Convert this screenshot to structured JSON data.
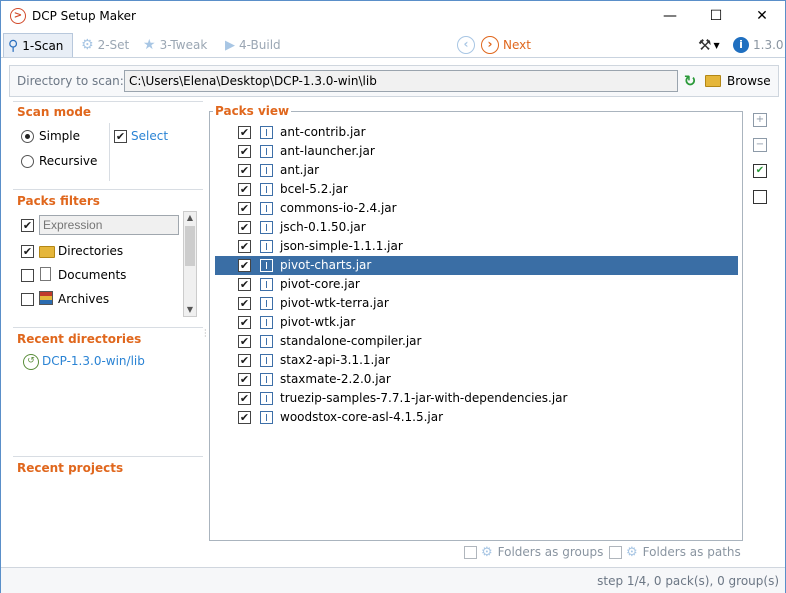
{
  "window": {
    "title": "DCP Setup Maker",
    "minimize": "—",
    "maximize": "☐",
    "close": "✕"
  },
  "steps": [
    {
      "label": "1-Scan",
      "state": "active"
    },
    {
      "label": "2-Set",
      "state": "disabled"
    },
    {
      "label": "3-Tweak",
      "state": "disabled"
    },
    {
      "label": "4-Build",
      "state": "disabled"
    }
  ],
  "nav": {
    "next_label": "Next",
    "version": "1.3.0"
  },
  "directory": {
    "label": "Directory to scan:",
    "value": "C:\\Users\\Elena\\Desktop\\DCP-1.3.0-win\\lib",
    "browse_label": "Browse"
  },
  "scan_mode": {
    "title": "Scan mode",
    "simple_label": "Simple",
    "recursive_label": "Recursive",
    "select_label": "Select",
    "selected": "simple"
  },
  "packs_filters": {
    "title": "Packs filters",
    "expression_placeholder": "Expression",
    "items": [
      {
        "label": "Directories",
        "checked": true
      },
      {
        "label": "Documents",
        "checked": false
      },
      {
        "label": "Archives",
        "checked": false
      }
    ]
  },
  "recent_directories": {
    "title": "Recent directories",
    "items": [
      "DCP-1.3.0-win/lib"
    ]
  },
  "recent_projects": {
    "title": "Recent projects"
  },
  "packs_view": {
    "title": "Packs view",
    "selected_index": 7,
    "items": [
      "ant-contrib.jar",
      "ant-launcher.jar",
      "ant.jar",
      "bcel-5.2.jar",
      "commons-io-2.4.jar",
      "jsch-0.1.50.jar",
      "json-simple-1.1.1.jar",
      "pivot-charts.jar",
      "pivot-core.jar",
      "pivot-wtk-terra.jar",
      "pivot-wtk.jar",
      "standalone-compiler.jar",
      "stax2-api-3.1.1.jar",
      "staxmate-2.2.0.jar",
      "truezip-samples-7.7.1-jar-with-dependencies.jar",
      "woodstox-core-asl-4.1.5.jar"
    ]
  },
  "options": {
    "folders_as_groups": "Folders as groups",
    "folders_as_paths": "Folders as paths"
  },
  "status": {
    "text": "step 1/4, 0 pack(s), 0 group(s)"
  },
  "colors": {
    "accent_orange": "#e0671d",
    "link_blue": "#2a83d4",
    "selection": "#3a6ea5"
  }
}
